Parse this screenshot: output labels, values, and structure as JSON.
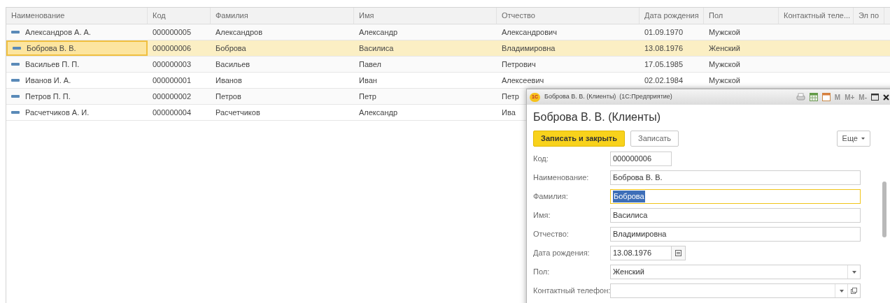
{
  "table": {
    "columns": [
      "Наименование",
      "Код",
      "Фамилия",
      "Имя",
      "Отчество",
      "Дата рождения",
      "Пол",
      "Контактный теле...",
      "Эл по"
    ],
    "rows": [
      {
        "selected": false,
        "cells": [
          "Александров А. А.",
          "000000005",
          "Александров",
          "Александр",
          "Александрович",
          "01.09.1970",
          "Мужской"
        ]
      },
      {
        "selected": true,
        "cells": [
          "Боброва В. В.",
          "000000006",
          "Боброва",
          "Василиса",
          "Владимировна",
          "13.08.1976",
          "Женский"
        ]
      },
      {
        "selected": false,
        "cells": [
          "Васильев П. П.",
          "000000003",
          "Васильев",
          "Павел",
          "Петрович",
          "17.05.1985",
          "Мужской"
        ]
      },
      {
        "selected": false,
        "cells": [
          "Иванов И. А.",
          "000000001",
          "Иванов",
          "Иван",
          "Алексеевич",
          "02.02.1984",
          "Мужской"
        ]
      },
      {
        "selected": false,
        "cells": [
          "Петров П. П.",
          "000000002",
          "Петров",
          "Петр",
          "Петр"
        ]
      },
      {
        "selected": false,
        "cells": [
          "Расчетчиков А. И.",
          "000000004",
          "Расчетчиков",
          "Александр",
          "Ива"
        ]
      }
    ]
  },
  "dialog": {
    "logo": "1С",
    "title": "Боброва В. В. (Клиенты)  (1С:Предприятие)",
    "memory_buttons": [
      "M",
      "M+",
      "M-"
    ],
    "heading": "Боброва В. В. (Клиенты)",
    "buttons": [
      {
        "label": "Записать и закрыть",
        "kind": "primary"
      },
      {
        "label": "Записать",
        "kind": "normal"
      }
    ],
    "more": "Еще",
    "fields": [
      {
        "label": "Код:",
        "value": "000000006",
        "kind": "short",
        "focused": false
      },
      {
        "label": "Наименование:",
        "value": "Боброва В. В.",
        "kind": "text",
        "focused": false
      },
      {
        "label": "Фамилия:",
        "value": "Боброва",
        "kind": "text",
        "focused": true
      },
      {
        "label": "Имя:",
        "value": "Василиса",
        "kind": "text",
        "focused": false
      },
      {
        "label": "Отчество:",
        "value": "Владимировна",
        "kind": "text",
        "focused": false
      },
      {
        "label": "Дата рождения:",
        "value": "13.08.1976",
        "kind": "date",
        "focused": false
      },
      {
        "label": "Пол:",
        "value": "Женский",
        "kind": "select",
        "focused": false
      },
      {
        "label": "Контактный телефон:",
        "kind": "select_open",
        "focused": false
      }
    ]
  }
}
